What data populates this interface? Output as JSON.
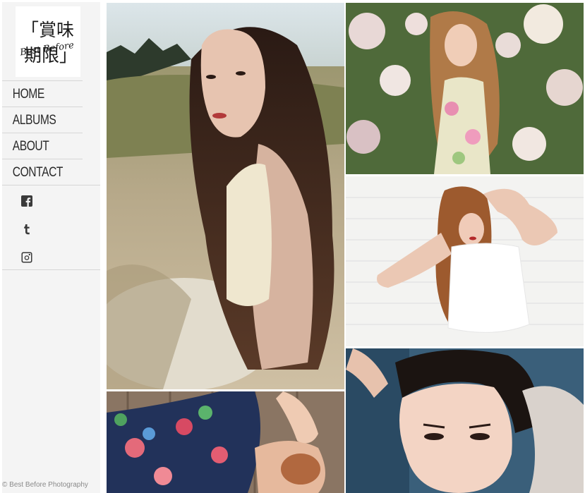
{
  "site": {
    "logo": {
      "kanji_top": "「賞味",
      "kanji_bottom": "期限」",
      "script_text": "Best Before"
    },
    "footer": "© Best Before Photography"
  },
  "nav": {
    "items": [
      {
        "label": "HOME"
      },
      {
        "label": "ALBUMS"
      },
      {
        "label": "ABOUT"
      },
      {
        "label": "CONTACT"
      }
    ]
  },
  "social": [
    {
      "icon": "facebook-icon"
    },
    {
      "icon": "tumblr-icon"
    },
    {
      "icon": "instagram-icon"
    }
  ],
  "gallery": [
    {
      "subject": "woman-long-hair-grass-field"
    },
    {
      "subject": "woman-floral-dress-flowers"
    },
    {
      "subject": "woman-white-top-brick-wall"
    },
    {
      "subject": "person-floral-shirt-lying-on-deck"
    },
    {
      "subject": "short-hair-portrait-blue-background"
    }
  ],
  "colors": {
    "sidebar_bg": "#f4f4f4",
    "nav_text": "#2a2a2a",
    "divider": "#d6d6d6",
    "footer_text": "#8a8a8a"
  }
}
